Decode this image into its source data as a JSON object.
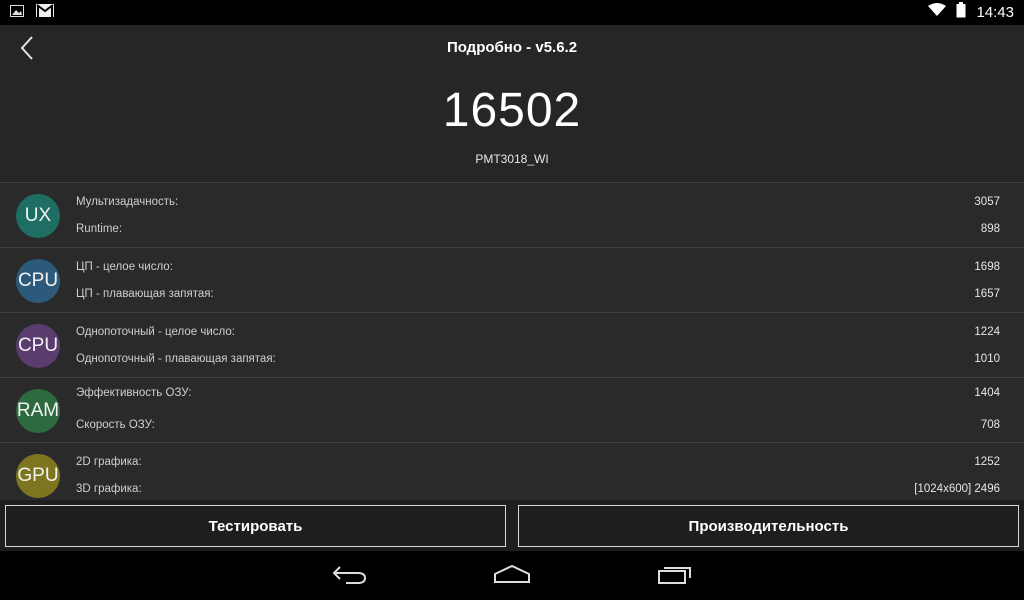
{
  "status_bar": {
    "icons_left": [
      "image-icon",
      "gmail-icon"
    ],
    "icons_right": [
      "wifi-icon",
      "battery-icon"
    ],
    "time": "14:43"
  },
  "header": {
    "title": "Подробно - v5.6.2",
    "total_score": "16502",
    "device": "PMT3018_WI"
  },
  "groups": [
    {
      "badge": "UX",
      "color": "#1f6e63",
      "rows": [
        {
          "label": "Мультизадачность:",
          "value": "3057"
        },
        {
          "label": "Runtime:",
          "value": "898"
        }
      ]
    },
    {
      "badge": "CPU",
      "color": "#2d5a7a",
      "rows": [
        {
          "label": "ЦП - целое число:",
          "value": "1698"
        },
        {
          "label": "ЦП - плавающая запятая:",
          "value": "1657"
        }
      ]
    },
    {
      "badge": "CPU",
      "color": "#5a3c6e",
      "rows": [
        {
          "label": "Однопоточный - целое число:",
          "value": "1224"
        },
        {
          "label": "Однопоточный - плавающая запятая:",
          "value": "1010"
        }
      ]
    },
    {
      "badge": "RAM",
      "color": "#2d6b3e",
      "rows": [
        {
          "label": "Эффективность ОЗУ:",
          "value": "1404"
        },
        {
          "label": "Скорость ОЗУ:",
          "value": "708"
        }
      ]
    },
    {
      "badge": "GPU",
      "color": "#7d7520",
      "rows": [
        {
          "label": "2D графика:",
          "value": "1252"
        },
        {
          "label": "3D графика:",
          "value": "[1024x600] 2496"
        }
      ]
    }
  ],
  "buttons": {
    "test": "Тестировать",
    "performance": "Производительность"
  }
}
